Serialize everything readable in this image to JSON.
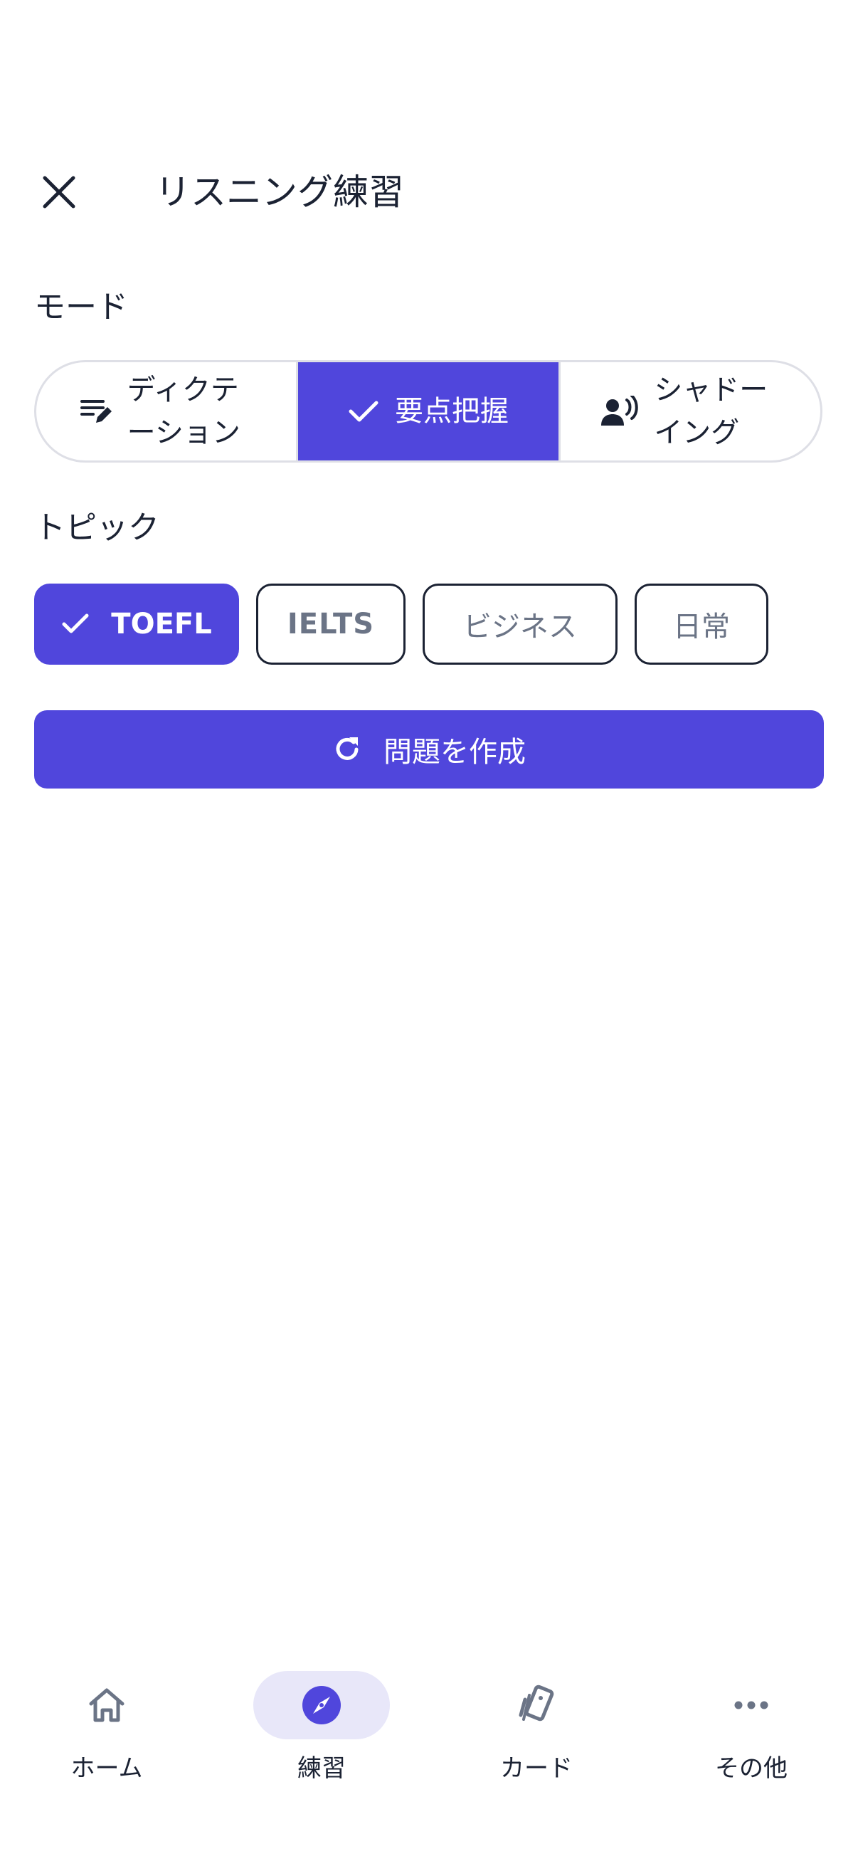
{
  "header": {
    "title": "リスニング練習",
    "close_icon": "close-icon"
  },
  "mode": {
    "label": "モード",
    "options": [
      {
        "label": "ディクテーション",
        "icon": "dictation-icon",
        "selected": false
      },
      {
        "label": "要点把握",
        "icon": "check-icon",
        "selected": true
      },
      {
        "label": "シャドーイング",
        "icon": "speaking-person-icon",
        "selected": false
      }
    ]
  },
  "topic": {
    "label": "トピック",
    "chips": [
      {
        "label": "TOEFL",
        "selected": true
      },
      {
        "label": "IELTS",
        "selected": false
      },
      {
        "label": "ビジネス",
        "selected": false
      },
      {
        "label": "日常",
        "selected": false
      }
    ]
  },
  "generate_button": {
    "label": "問題を作成",
    "icon": "refresh-icon"
  },
  "bottom_nav": {
    "items": [
      {
        "label": "ホーム",
        "icon": "home-icon",
        "active": false
      },
      {
        "label": "練習",
        "icon": "compass-icon",
        "active": true
      },
      {
        "label": "カード",
        "icon": "cards-icon",
        "active": false
      },
      {
        "label": "その他",
        "icon": "more-icon",
        "active": false
      }
    ]
  },
  "colors": {
    "accent": "#5046dc",
    "accent_soft": "#e8e7f9",
    "text": "#1b2233",
    "muted": "#6b7486",
    "border": "#dedfe6"
  }
}
